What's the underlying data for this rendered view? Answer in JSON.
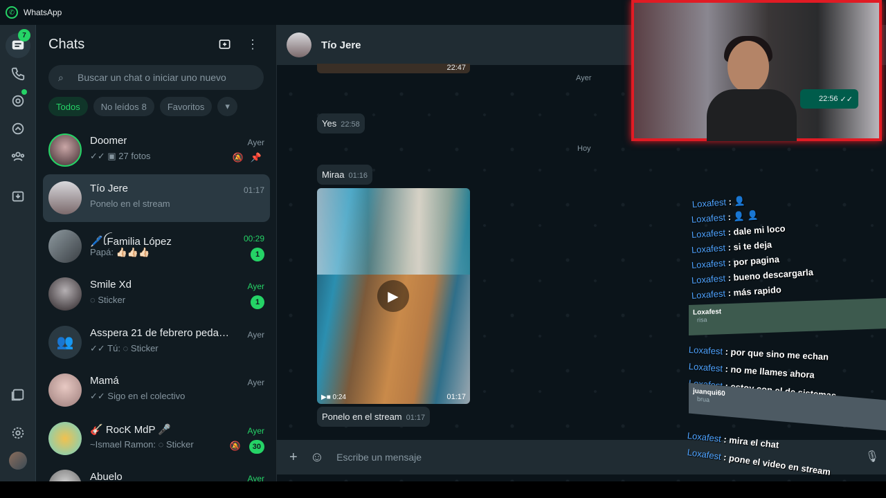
{
  "app": {
    "title": "WhatsApp"
  },
  "rail": {
    "chats_badge": "7"
  },
  "sidebar": {
    "title": "Chats",
    "search_placeholder": "Buscar un chat o iniciar uno nuevo",
    "filters": [
      {
        "label": "Todos",
        "active": true
      },
      {
        "label": "No leídos",
        "count": "8"
      },
      {
        "label": "Favoritos"
      }
    ],
    "chats": [
      {
        "name": "Doomer",
        "time": "Ayer",
        "preview": "✓✓ ▣ 27 fotos",
        "muted": true,
        "pinned": true
      },
      {
        "name": "Tío Jere",
        "time": "01:17",
        "preview": "Ponelo en el stream",
        "selected": true
      },
      {
        "name": "🖊️ꪶFamilia López",
        "time": "00:29",
        "time_green": true,
        "preview": "Papá: 👍🏻👍🏻👍🏻",
        "unread": "1"
      },
      {
        "name": "Smile Xd",
        "time": "Ayer",
        "time_green": true,
        "preview": "◌ Sticker",
        "unread": "1"
      },
      {
        "name": "Asspera 21 de febrero pedazo...",
        "time": "Ayer",
        "preview": "✓✓ Tú: ◌ Sticker"
      },
      {
        "name": "Mamá",
        "time": "Ayer",
        "preview": "✓✓ Sigo en el colectivo"
      },
      {
        "name": "🎸 RocK MdP 🎤",
        "time": "Ayer",
        "time_green": true,
        "preview": "~Ismael Ramon: ◌ Sticker",
        "unread": "30",
        "muted": true
      },
      {
        "name": "Abuelo",
        "time": "Ayer",
        "time_green": true,
        "preview": ""
      }
    ]
  },
  "conversation": {
    "contact": "Tío Jere",
    "top_time": "22:47",
    "day1": "Ayer",
    "msg1": {
      "text": "Yes",
      "time": "22:58"
    },
    "day2": "Hoy",
    "msg2": {
      "text": "Miraa",
      "time": "01:16"
    },
    "video": {
      "duration": "0:24",
      "time": "01:17"
    },
    "msg3": {
      "text": "Ponelo en el stream",
      "time": "01:17"
    },
    "composer_placeholder": "Escribe un mensaje"
  },
  "overlay": {
    "cam_bubble_time": "22:56",
    "stream_chat": [
      {
        "user": "Loxafest",
        "msg": "👤"
      },
      {
        "user": "Loxafest",
        "msg": "👤 👤"
      },
      {
        "user": "Loxafest",
        "msg": "dale mi loco"
      },
      {
        "user": "Loxafest",
        "msg": "si te deja"
      },
      {
        "user": "Loxafest",
        "msg": "por pagina"
      },
      {
        "user": "Loxafest",
        "msg": "bueno descargarla"
      },
      {
        "user": "Loxafest",
        "msg": "más rapido"
      },
      {
        "user": "Loxafest",
        "msg": "por que sino me echan"
      },
      {
        "user": "Loxafest",
        "msg": "no me llames ahora"
      },
      {
        "user": "Loxafest",
        "msg": "estoy con el de sistemas"
      },
      {
        "user": "Loxafest",
        "msg": "mira el chat"
      },
      {
        "user": "Loxafest",
        "msg": "pone el video en stream"
      }
    ],
    "highlight1": {
      "user": "Loxafest",
      "msg": "risa"
    },
    "highlight2": {
      "user": "juanqui60",
      "msg": "brua"
    }
  },
  "colors": {
    "accent": "#25d366",
    "bg": "#111b21",
    "panel": "#202c33",
    "stream_border": "#e01b24"
  }
}
